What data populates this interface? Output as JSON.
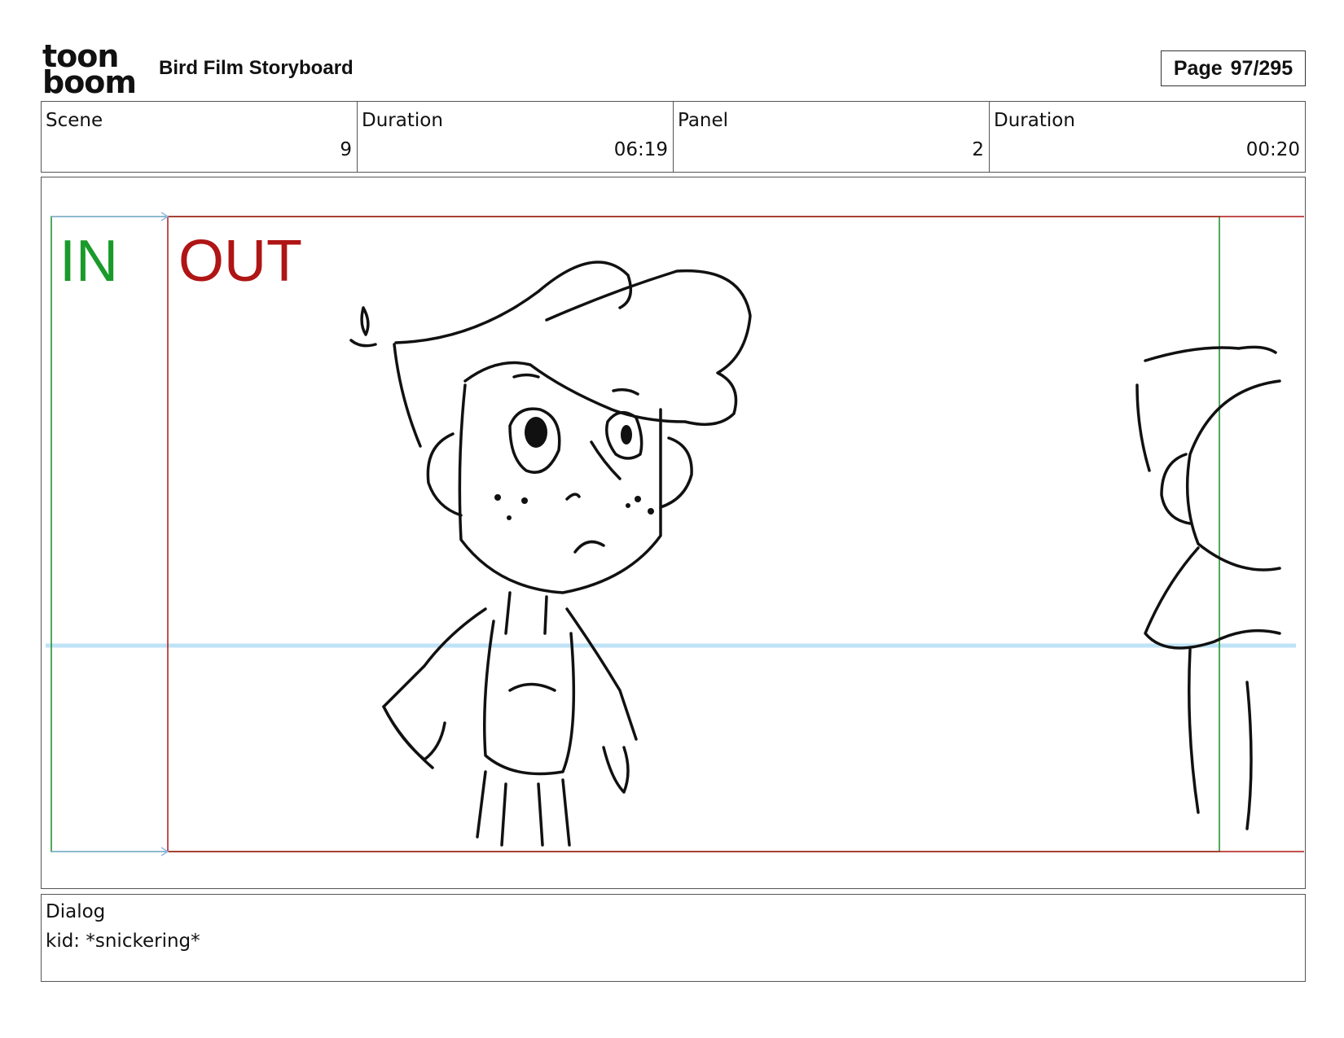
{
  "header": {
    "logo_line1": "toon",
    "logo_line2": "boom",
    "title": "Bird Film Storyboard",
    "page_label": "Page",
    "page_value": "97/295"
  },
  "info": [
    {
      "label": "Scene",
      "value": "9"
    },
    {
      "label": "Duration",
      "value": "06:19"
    },
    {
      "label": "Panel",
      "value": "2"
    },
    {
      "label": "Duration",
      "value": "00:20"
    }
  ],
  "panel": {
    "in_label": "IN",
    "out_label": "OUT",
    "colors": {
      "in": "#1a9a2a",
      "out": "#b01515",
      "horizon": "#bfe3f6",
      "arrow": "#8fb6e0"
    }
  },
  "dialog": {
    "label": "Dialog",
    "text": "kid: *snickering*"
  }
}
